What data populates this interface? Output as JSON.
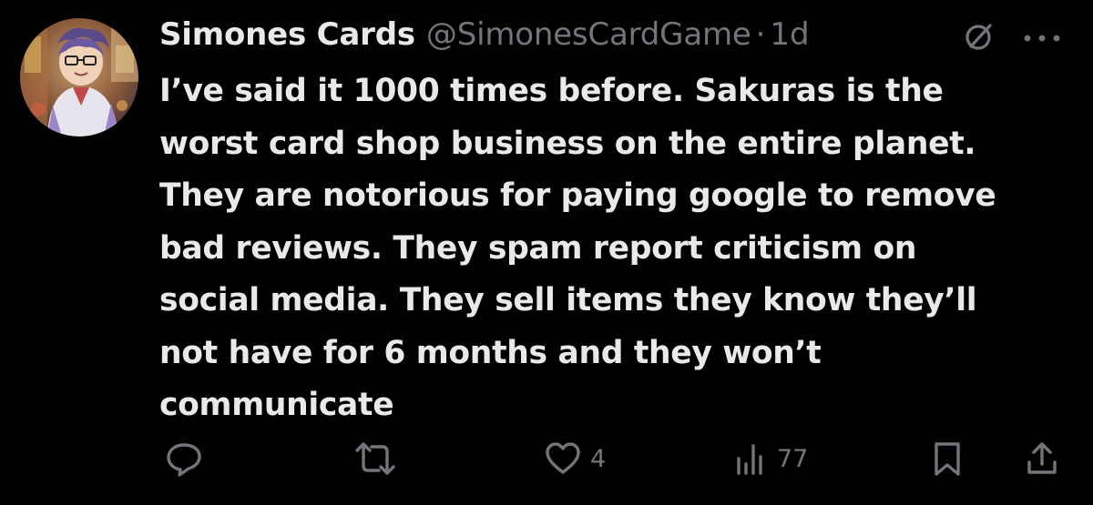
{
  "tweet": {
    "display_name": "Simones Cards",
    "handle": "@SimonesCardGame",
    "separator": "·",
    "time": "1d",
    "text": "I’ve said it 1000 times before. Sakuras is the\nworst card shop business on the entire planet.\nThey are notorious for paying google to remove\nbad reviews. They spam report criticism on\nsocial media. They sell items they know they’ll\nnot have for 6 months and they won’t\ncommunicate"
  },
  "actions": {
    "reply_icon": "reply-icon",
    "repost_icon": "repost-icon",
    "like_icon": "heart-icon",
    "like_count": "4",
    "views_icon": "views-chart-icon",
    "views_count": "77",
    "bookmark_icon": "bookmark-icon",
    "share_icon": "share-icon"
  },
  "header_icons": {
    "grok": "grok-icon",
    "more": "more-icon"
  },
  "colors": {
    "background": "#000000",
    "primary_text": "#e7e9ea",
    "secondary_text": "#71767b"
  }
}
